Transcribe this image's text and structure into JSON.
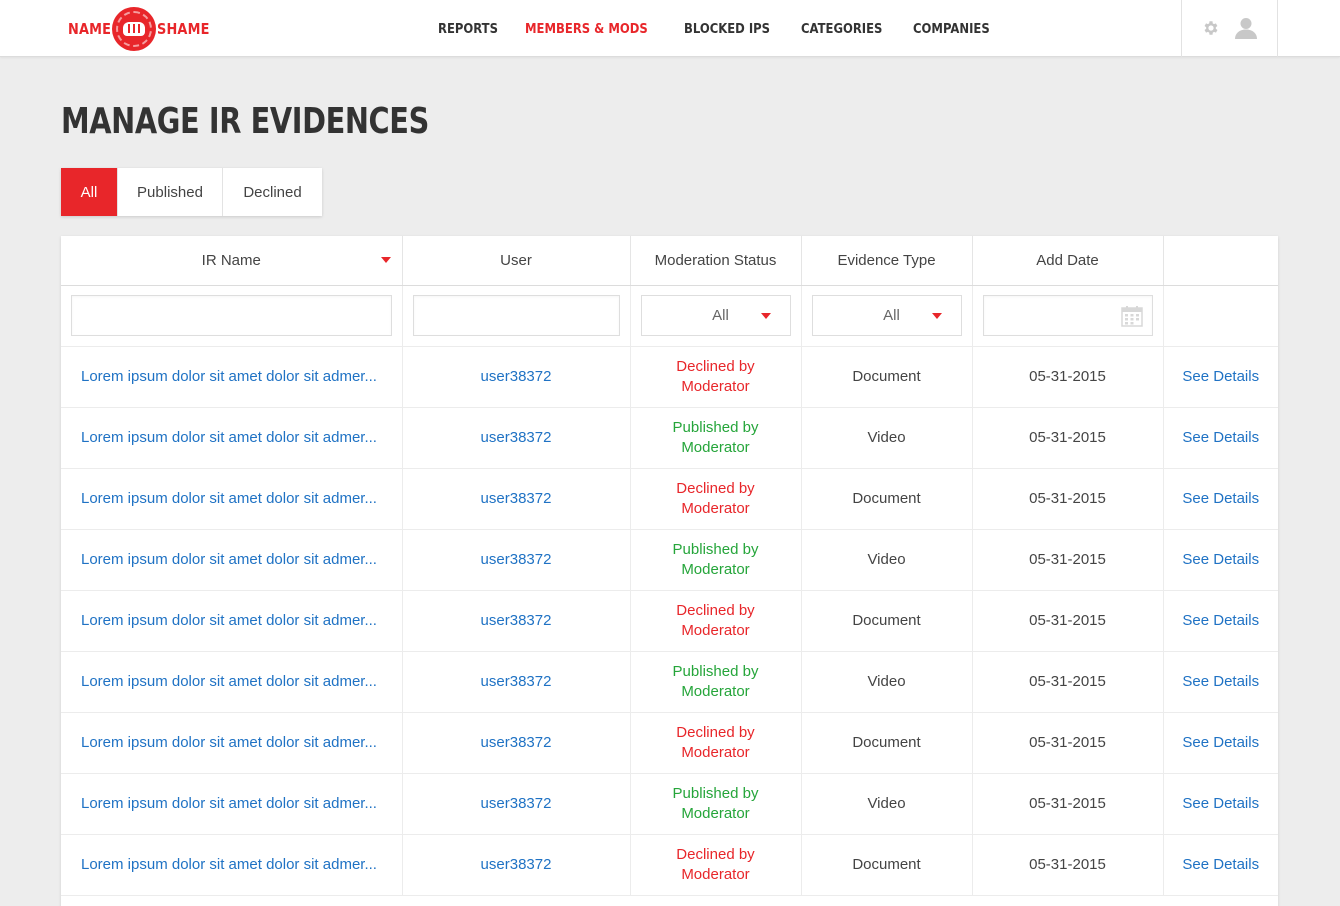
{
  "brand": {
    "left_word": "NAME",
    "right_word": "SHAME",
    "accent_color": "#e8262a"
  },
  "nav": [
    {
      "label": "REPORTS",
      "active": false
    },
    {
      "label": "MEMBERS & MODS",
      "active": true
    },
    {
      "label": "BLOCKED IPS",
      "active": false
    },
    {
      "label": "CATEGORIES",
      "active": false
    },
    {
      "label": "COMPANIES",
      "active": false
    }
  ],
  "header_tools": {
    "settings_icon": "gear-icon",
    "profile_icon": "user-icon"
  },
  "page_title": "MANAGE IR EVIDENCES",
  "tabs": [
    {
      "label": "All",
      "active": true
    },
    {
      "label": "Published",
      "active": false
    },
    {
      "label": "Declined",
      "active": false
    }
  ],
  "table": {
    "columns": [
      "IR Name",
      "User",
      "Moderation Status",
      "Evidence Type",
      "Add Date",
      ""
    ],
    "sorted_column": "IR Name",
    "filters": {
      "ir_name": "",
      "user": "",
      "moderation_status": "All",
      "evidence_type": "All",
      "add_date": ""
    },
    "rows": [
      {
        "ir_name": "Lorem ipsum dolor sit amet dolor sit admer...",
        "user": "user38372",
        "status_line1": "Declined by",
        "status_line2": "Moderator",
        "status": "declined",
        "evidence_type": "Document",
        "add_date": "05-31-2015",
        "action": "See Details"
      },
      {
        "ir_name": "Lorem ipsum dolor sit amet dolor sit admer...",
        "user": "user38372",
        "status_line1": "Published by",
        "status_line2": "Moderator",
        "status": "published",
        "evidence_type": "Video",
        "add_date": "05-31-2015",
        "action": "See Details"
      },
      {
        "ir_name": "Lorem ipsum dolor sit amet dolor sit admer...",
        "user": "user38372",
        "status_line1": "Declined by",
        "status_line2": "Moderator",
        "status": "declined",
        "evidence_type": "Document",
        "add_date": "05-31-2015",
        "action": "See Details"
      },
      {
        "ir_name": "Lorem ipsum dolor sit amet dolor sit admer...",
        "user": "user38372",
        "status_line1": "Published by",
        "status_line2": "Moderator",
        "status": "published",
        "evidence_type": "Video",
        "add_date": "05-31-2015",
        "action": "See Details"
      },
      {
        "ir_name": "Lorem ipsum dolor sit amet dolor sit admer...",
        "user": "user38372",
        "status_line1": "Declined by",
        "status_line2": "Moderator",
        "status": "declined",
        "evidence_type": "Document",
        "add_date": "05-31-2015",
        "action": "See Details"
      },
      {
        "ir_name": "Lorem ipsum dolor sit amet dolor sit admer...",
        "user": "user38372",
        "status_line1": "Published by",
        "status_line2": "Moderator",
        "status": "published",
        "evidence_type": "Video",
        "add_date": "05-31-2015",
        "action": "See Details"
      },
      {
        "ir_name": "Lorem ipsum dolor sit amet dolor sit admer...",
        "user": "user38372",
        "status_line1": "Declined by",
        "status_line2": "Moderator",
        "status": "declined",
        "evidence_type": "Document",
        "add_date": "05-31-2015",
        "action": "See Details"
      },
      {
        "ir_name": "Lorem ipsum dolor sit amet dolor sit admer...",
        "user": "user38372",
        "status_line1": "Published by",
        "status_line2": "Moderator",
        "status": "published",
        "evidence_type": "Video",
        "add_date": "05-31-2015",
        "action": "See Details"
      },
      {
        "ir_name": "Lorem ipsum dolor sit amet dolor sit admer...",
        "user": "user38372",
        "status_line1": "Declined by",
        "status_line2": "Moderator",
        "status": "declined",
        "evidence_type": "Document",
        "add_date": "05-31-2015",
        "action": "See Details"
      }
    ]
  }
}
